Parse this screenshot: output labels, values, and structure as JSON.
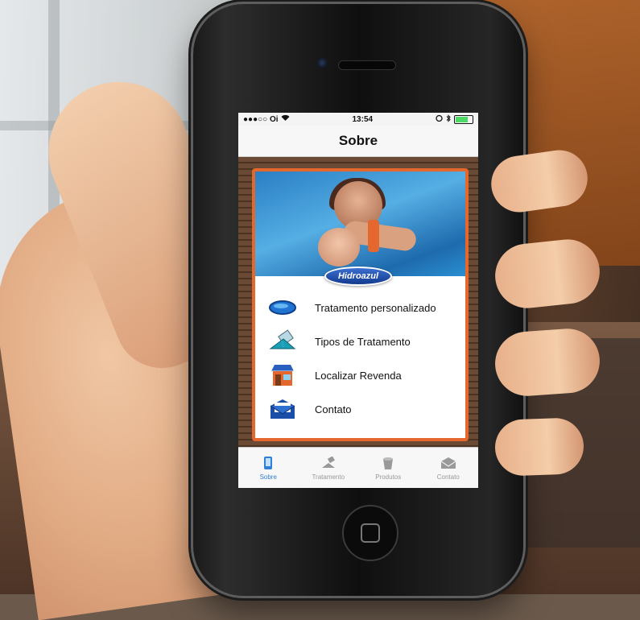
{
  "status_bar": {
    "carrier": "●●●○○ Oi",
    "time": "13:54"
  },
  "navbar": {
    "title": "Sobre"
  },
  "hero": {
    "brand_logo": "Hidroazul"
  },
  "menu": {
    "items": [
      {
        "label": "Tratamento personalizado",
        "icon": "pool-icon"
      },
      {
        "label": "Tipos de Tratamento",
        "icon": "chemical-pour-icon"
      },
      {
        "label": "Localizar Revenda",
        "icon": "store-icon"
      },
      {
        "label": "Contato",
        "icon": "mail-icon"
      }
    ]
  },
  "tabbar": {
    "tabs": [
      {
        "label": "Sobre",
        "icon": "phone-icon",
        "active": true
      },
      {
        "label": "Tratamento",
        "icon": "pour-icon",
        "active": false
      },
      {
        "label": "Produtos",
        "icon": "bucket-icon",
        "active": false
      },
      {
        "label": "Contato",
        "icon": "envelope-icon",
        "active": false
      }
    ]
  },
  "colors": {
    "accent": "#e4672d",
    "tab_active": "#2f7fd6",
    "brand_blue": "#1e5bbf"
  }
}
